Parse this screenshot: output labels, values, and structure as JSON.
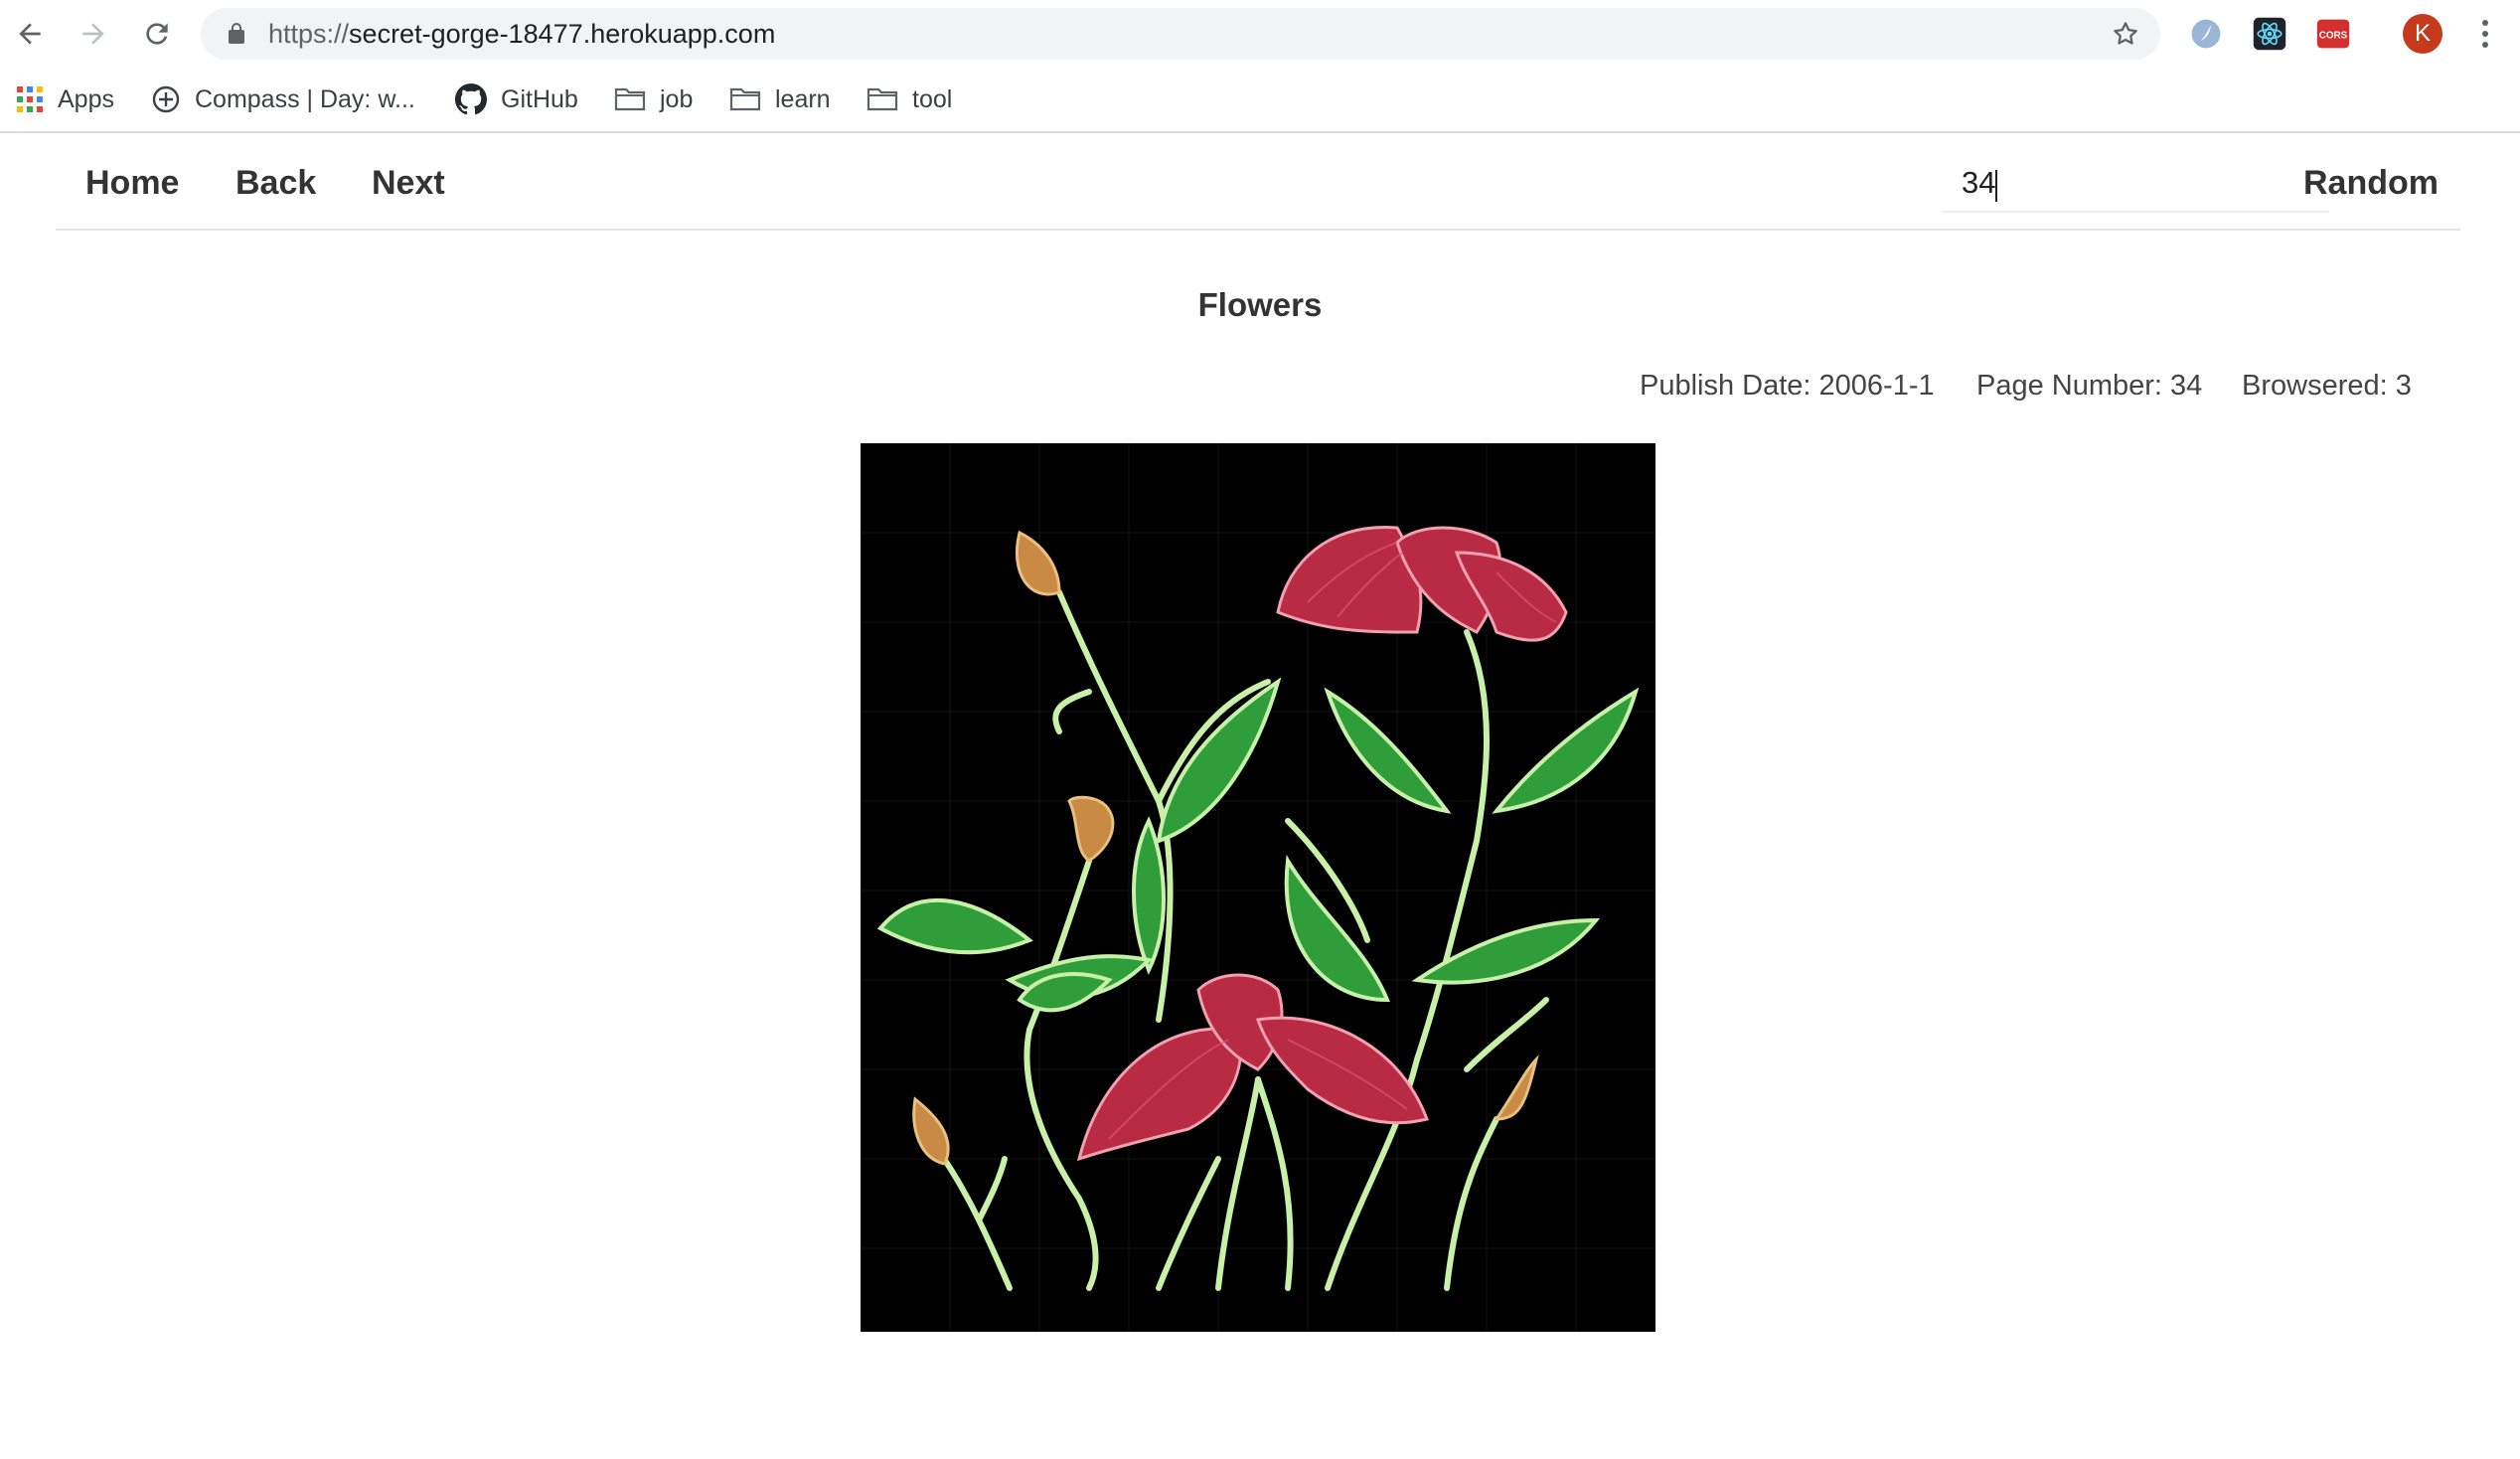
{
  "browser": {
    "url_scheme": "https://",
    "url_host": "secret-gorge-18477.herokuapp.com",
    "profile_initial": "K",
    "extensions": [
      "theme-ext-icon",
      "react-devtools-icon",
      "cors-icon"
    ],
    "cors_label": "CORS"
  },
  "bookmarks": {
    "apps": "Apps",
    "compass": "Compass | Day: w...",
    "github": "GitHub",
    "job": "job",
    "learn": "learn",
    "tool": "tool"
  },
  "nav": {
    "home": "Home",
    "back": "Back",
    "next": "Next",
    "page_input_value": "34",
    "random": "Random"
  },
  "article": {
    "title": "Flowers",
    "publish_date": "Publish Date: 2006-1-1",
    "page_number": "Page Number: 34",
    "browsered": "Browsered: 3"
  },
  "colors": {
    "petal": "#c8324a",
    "stem": "#c8f0a8",
    "leaf": "#3cae3c",
    "bud": "#c98a45"
  }
}
